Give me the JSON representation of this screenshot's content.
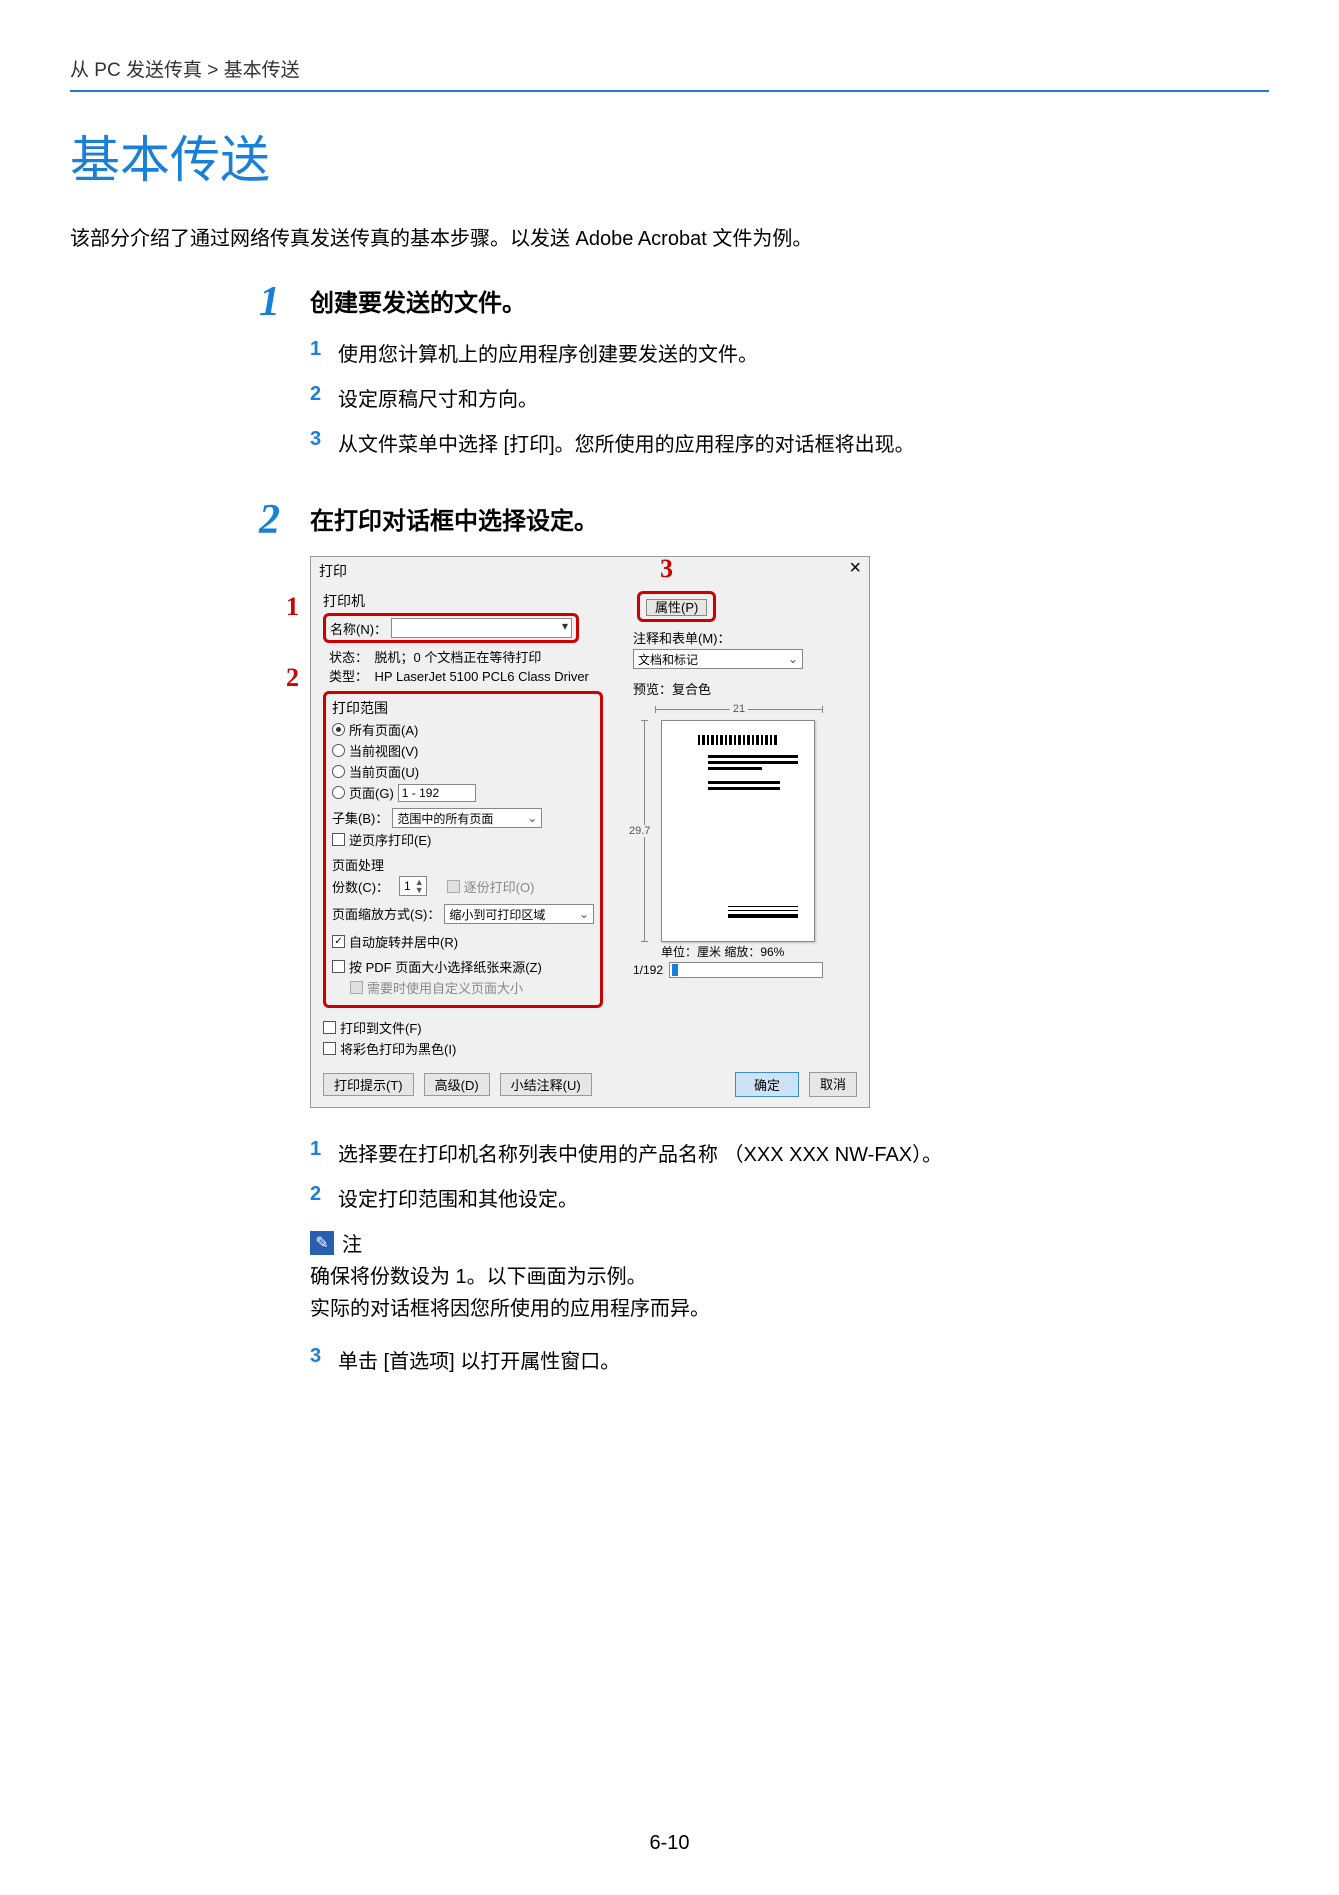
{
  "breadcrumb": "从 PC 发送传真 > 基本传送",
  "title": "基本传送",
  "intro": "该部分介绍了通过网络传真发送传真的基本步骤。以发送 Adobe Acrobat 文件为例。",
  "steps": [
    {
      "num": "1",
      "title": "创建要发送的文件。",
      "subs": [
        {
          "n": "1",
          "t": "使用您计算机上的应用程序创建要发送的文件。"
        },
        {
          "n": "2",
          "t": "设定原稿尺寸和方向。"
        },
        {
          "n": "3",
          "t": "从文件菜单中选择 [打印]。您所使用的应用程序的对话框将出现。"
        }
      ]
    },
    {
      "num": "2",
      "title": "在打印对话框中选择设定。",
      "callouts": {
        "c1": "1",
        "c2": "2",
        "c3": "3"
      },
      "dialog": {
        "title": "打印",
        "close": "×",
        "printer_group": "打印机",
        "name_label": "名称(N)：",
        "status_label": "状态：",
        "status_value": "脱机；0 个文档正在等待打印",
        "type_label": "类型：",
        "type_value": "HP LaserJet 5100 PCL6 Class Driver",
        "props_btn": "属性(P)",
        "comments_label": "注释和表单(M)：",
        "comments_value": "文档和标记",
        "range_group": "打印范围",
        "r_all": "所有页面(A)",
        "r_view": "当前视图(V)",
        "r_page": "当前页面(U)",
        "r_pages_label": "页面(G)",
        "r_pages_value": "1 - 192",
        "subset_label": "子集(B)：",
        "subset_value": "范围中的所有页面",
        "reverse": "逆页序打印(E)",
        "handling": "页面处理",
        "copies_label": "份数(C)：",
        "copies_value": "1",
        "collate": "逐份打印(O)",
        "scaling_label": "页面缩放方式(S)：",
        "scaling_value": "缩小到可打印区域",
        "autorotate": "自动旋转并居中(R)",
        "choose_by_pdf": "按 PDF 页面大小选择纸张来源(Z)",
        "use_custom": "需要时使用自定义页面大小",
        "print_to_file": "打印到文件(F)",
        "print_bw": "将彩色打印为黑色(I)",
        "preview_label": "预览：复合色",
        "ruler_h": "21",
        "ruler_v": "29.7",
        "units": "单位：厘米 缩放：96%",
        "prog_label": "1/192",
        "tips_btn": "打印提示(T)",
        "adv_btn": "高级(D)",
        "summ_btn": "小结注释(U)",
        "ok_btn": "确定",
        "cancel_btn": "取消"
      },
      "after": [
        {
          "n": "1",
          "t": "选择要在打印机名称列表中使用的产品名称 （XXX XXX NW-FAX）。"
        },
        {
          "n": "2",
          "t": "设定打印范围和其他设定。"
        }
      ],
      "note": {
        "label": "注",
        "lines": [
          "确保将份数设为 1。以下画面为示例。",
          "实际的对话框将因您所使用的应用程序而异。"
        ]
      },
      "after2": [
        {
          "n": "3",
          "t": "单击 [首选项] 以打开属性窗口。"
        }
      ]
    }
  ],
  "page_number": "6-10"
}
